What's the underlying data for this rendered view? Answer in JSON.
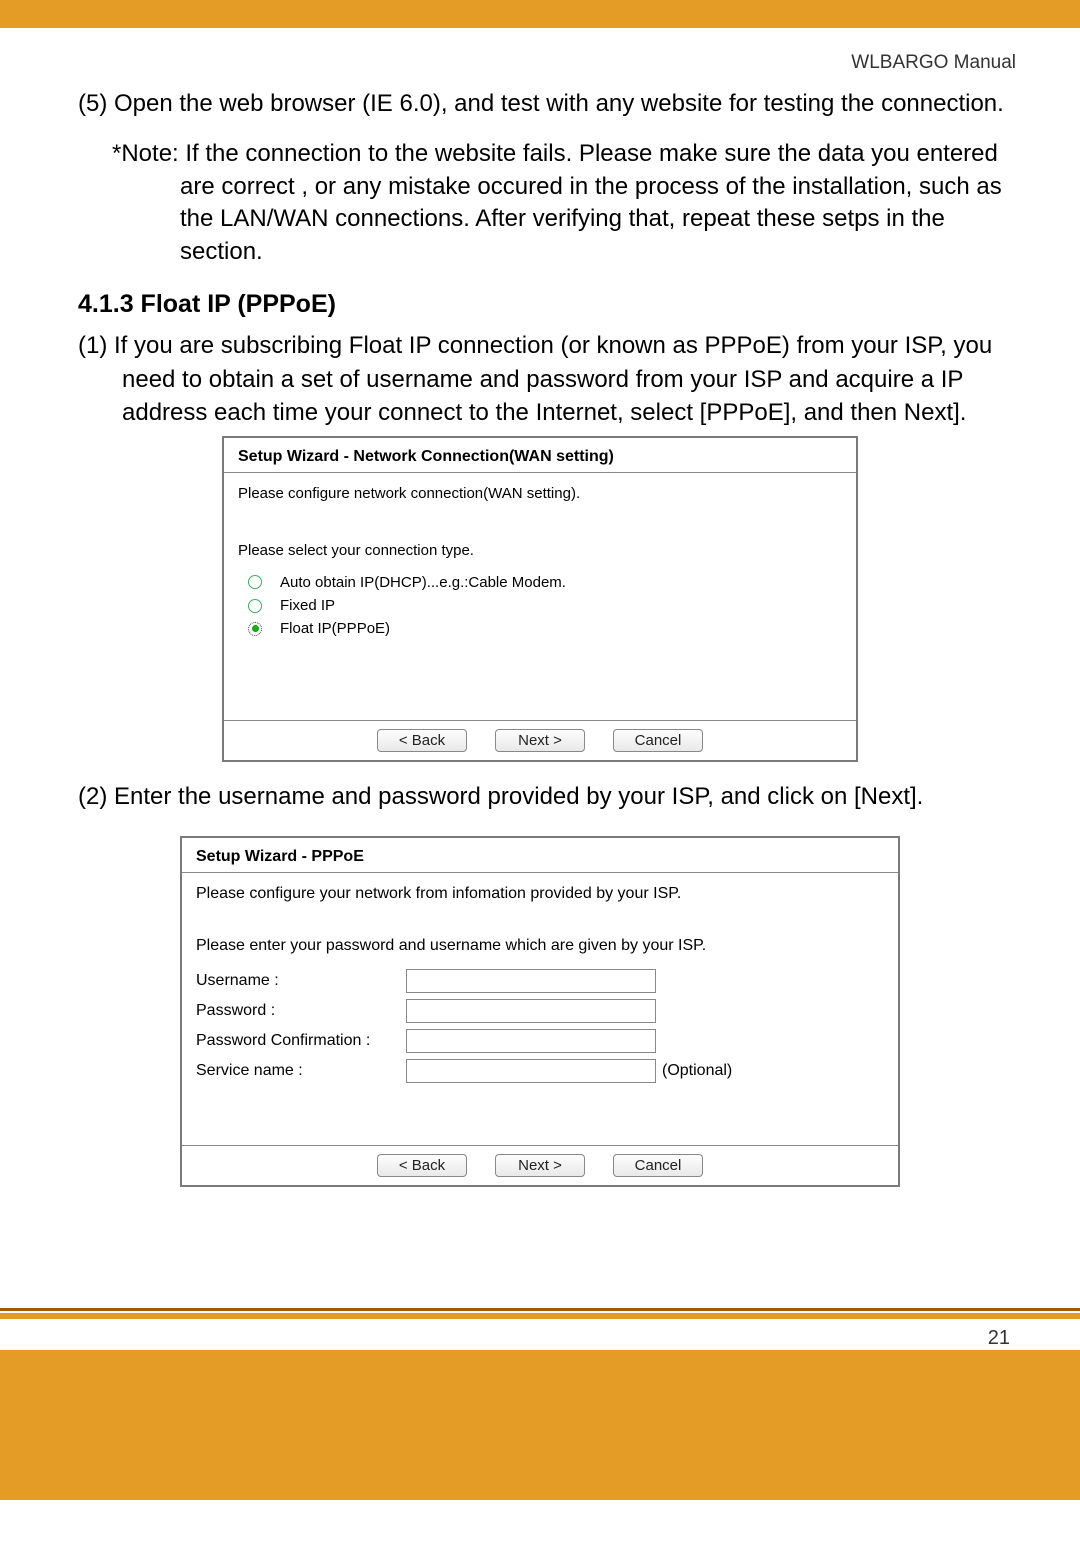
{
  "header": {
    "manual_name": "WLBARGO Manual"
  },
  "body": {
    "step5": "(5) Open the web browser (IE 6.0), and test with any website for testing the connection.",
    "note": "*Note: If the connection to the website fails. Please make sure the data you entered are correct , or any mistake occured in the process of the installation, such as the LAN/WAN connections. After verifying that, repeat these setps in the section.",
    "section_heading": "4.1.3 Float IP (PPPoE)",
    "step1": "(1) If you are subscribing Float IP connection (or known as PPPoE) from your ISP, you need to obtain a set of username and password from your ISP and acquire a IP address each time your connect to the Internet, select [PPPoE], and then Next].",
    "step2": "(2) Enter the username and password provided by your ISP, and click on [Next]."
  },
  "wizard1": {
    "title": "Setup Wizard - Network Connection(WAN setting)",
    "intro": "Please configure network connection(WAN setting).",
    "sub": "Please select your connection type.",
    "options": {
      "dhcp": "Auto obtain IP(DHCP)...e.g.:Cable Modem.",
      "fixed": "Fixed IP",
      "pppoe": "Float IP(PPPoE)"
    },
    "buttons": {
      "back": "< Back",
      "next": "Next >",
      "cancel": "Cancel"
    }
  },
  "wizard2": {
    "title": "Setup Wizard - PPPoE",
    "intro1": "Please configure your network from infomation provided by your ISP.",
    "intro2": "Please enter your password and username which are given by your ISP.",
    "labels": {
      "username": "Username :",
      "password": "Password :",
      "password_confirm": "Password Confirmation :",
      "service": "Service name :",
      "optional": "(Optional)"
    },
    "buttons": {
      "back": "< Back",
      "next": "Next >",
      "cancel": "Cancel"
    }
  },
  "footer": {
    "page_number": "21"
  }
}
